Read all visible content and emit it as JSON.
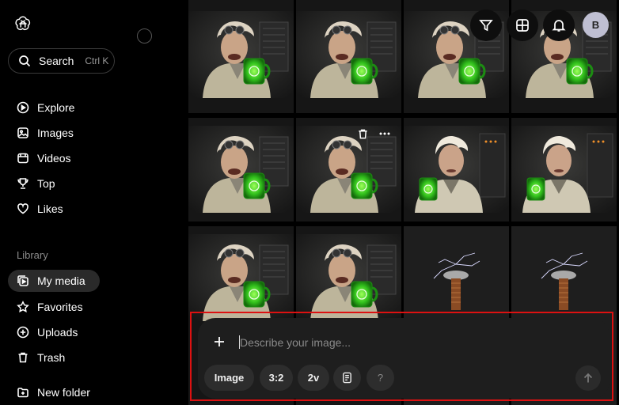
{
  "sidebar": {
    "search_label": "Search",
    "search_shortcut": "Ctrl K",
    "nav": [
      {
        "label": "Explore",
        "icon": "explore-icon"
      },
      {
        "label": "Images",
        "icon": "image-icon"
      },
      {
        "label": "Videos",
        "icon": "video-icon"
      },
      {
        "label": "Top",
        "icon": "trophy-icon"
      },
      {
        "label": "Likes",
        "icon": "heart-icon"
      }
    ],
    "library_label": "Library",
    "library": [
      {
        "label": "My media",
        "icon": "media-icon",
        "active": true
      },
      {
        "label": "Favorites",
        "icon": "star-icon"
      },
      {
        "label": "Uploads",
        "icon": "upload-icon"
      },
      {
        "label": "Trash",
        "icon": "trash-icon"
      }
    ],
    "new_folder_label": "New folder"
  },
  "header": {
    "avatar_initial": "B"
  },
  "composer": {
    "placeholder": "Describe your image...",
    "value": "",
    "mode_label": "Image",
    "aspect_label": "3:2",
    "count_label": "2v",
    "help_label": "?"
  },
  "colors": {
    "highlight": "#dd1111",
    "accent_green": "#39d23a"
  }
}
